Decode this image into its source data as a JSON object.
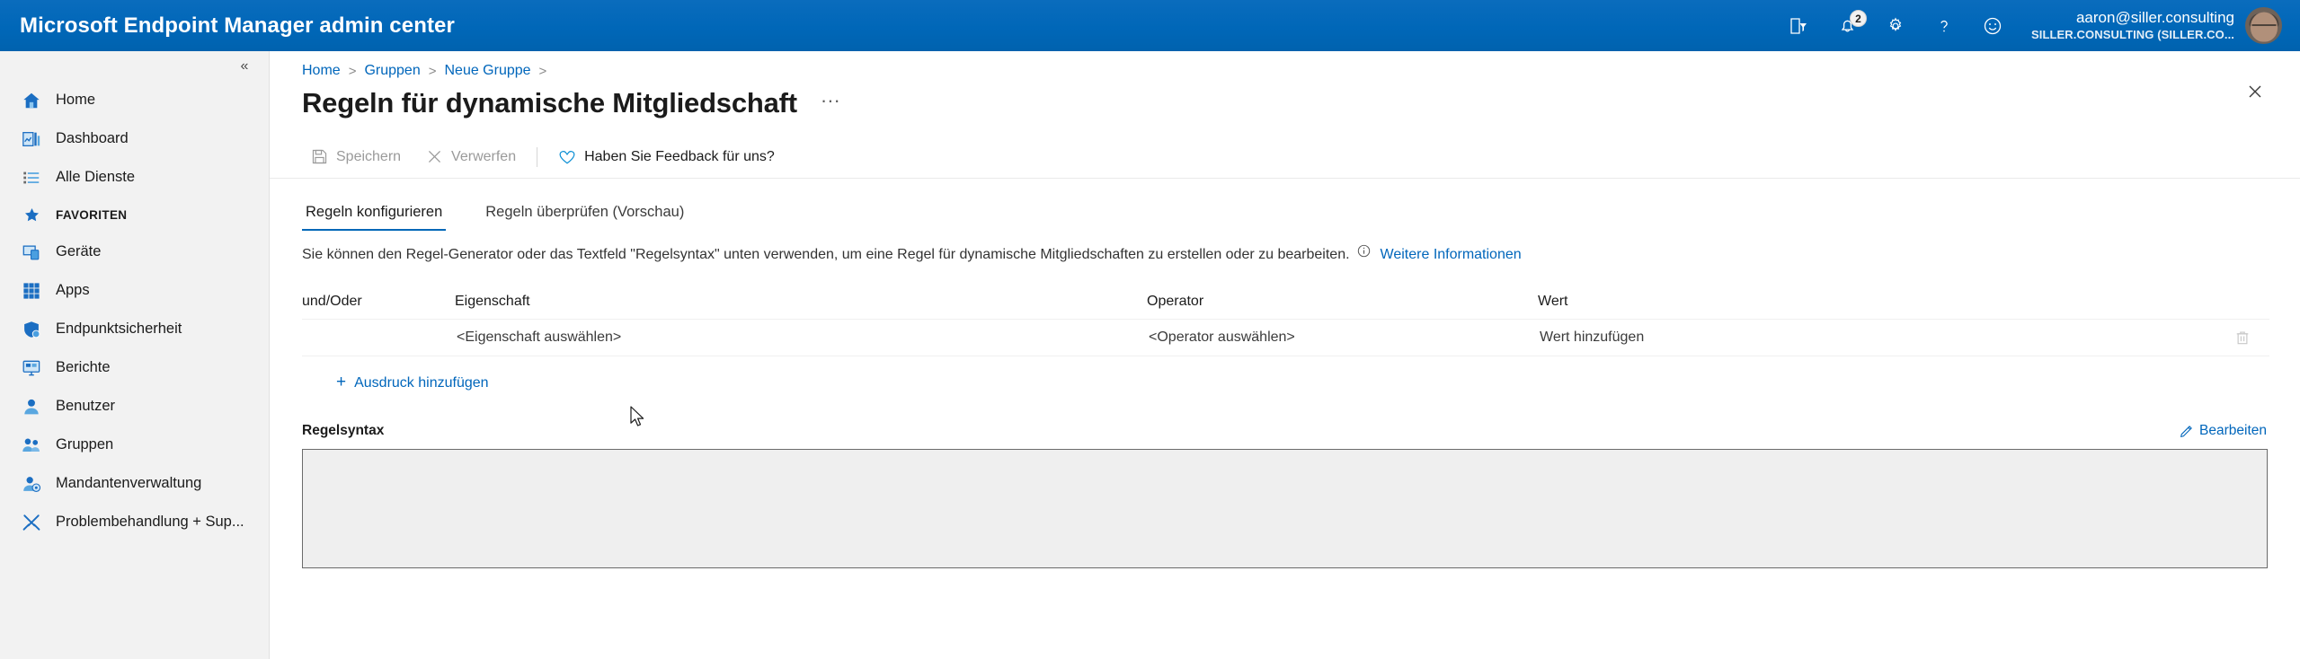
{
  "header": {
    "brand": "Microsoft Endpoint Manager admin center",
    "icons": [
      {
        "name": "cloud-shell-icon",
        "title": "Cloud Shell"
      },
      {
        "name": "notifications-bell-icon",
        "title": "Benachrichtigungen",
        "badge": "2"
      },
      {
        "name": "settings-gear-icon",
        "title": "Einstellungen"
      },
      {
        "name": "help-question-icon",
        "title": "Hilfe"
      },
      {
        "name": "feedback-smiley-icon",
        "title": "Feedback"
      }
    ],
    "account": {
      "email": "aaron@siller.consulting",
      "org": "SILLER.CONSULTING (SILLER.CO..."
    }
  },
  "sidebar": {
    "collapse_glyph": "«",
    "items": [
      {
        "label": "Home",
        "icon": "home-icon"
      },
      {
        "label": "Dashboard",
        "icon": "dashboard-icon"
      },
      {
        "label": "Alle Dienste",
        "icon": "all-services-icon"
      },
      {
        "label": "FAVORITEN",
        "icon": "star-icon",
        "section": true
      },
      {
        "label": "Geräte",
        "icon": "devices-icon"
      },
      {
        "label": "Apps",
        "icon": "apps-icon"
      },
      {
        "label": "Endpunktsicherheit",
        "icon": "endpoint-security-icon"
      },
      {
        "label": "Berichte",
        "icon": "reports-icon"
      },
      {
        "label": "Benutzer",
        "icon": "user-icon"
      },
      {
        "label": "Gruppen",
        "icon": "groups-icon"
      },
      {
        "label": "Mandantenverwaltung",
        "icon": "tenant-admin-icon"
      },
      {
        "label": "Problembehandlung + Sup...",
        "icon": "troubleshooting-icon"
      }
    ]
  },
  "breadcrumb": {
    "items": [
      "Home",
      "Gruppen",
      "Neue Gruppe"
    ],
    "separator": ">"
  },
  "page": {
    "title": "Regeln für dynamische Mitgliedschaft",
    "ellipsis": "···",
    "close_label": "Schließen"
  },
  "commandbar": {
    "save": "Speichern",
    "discard": "Verwerfen",
    "feedback": "Haben Sie Feedback für uns?"
  },
  "tabs": [
    {
      "label": "Regeln konfigurieren",
      "active": true
    },
    {
      "label": "Regeln überprüfen (Vorschau)",
      "active": false
    }
  ],
  "description": {
    "text": "Sie können den Regel-Generator oder das Textfeld \"Regelsyntax\" unten verwenden, um eine Regel für dynamische Mitgliedschaften zu erstellen oder zu bearbeiten.",
    "link": "Weitere Informationen"
  },
  "rule_table": {
    "columns": [
      "und/Oder",
      "Eigenschaft",
      "Operator",
      "Wert"
    ],
    "rows": [
      {
        "andor": "",
        "property": "<Eigenschaft auswählen>",
        "operator": "<Operator auswählen>",
        "value": "Wert hinzufügen"
      }
    ],
    "add_expression": "Ausdruck hinzufügen",
    "add_glyph": "+"
  },
  "rule_syntax": {
    "label": "Regelsyntax",
    "edit": "Bearbeiten",
    "value": "",
    "placeholder": ""
  },
  "colors": {
    "brand_blue": "#0067b8",
    "link_blue": "#0066bb",
    "sidebar_bg": "#f2f2f2",
    "syntax_bg": "#efefef",
    "text_primary": "#1b1b1b"
  }
}
